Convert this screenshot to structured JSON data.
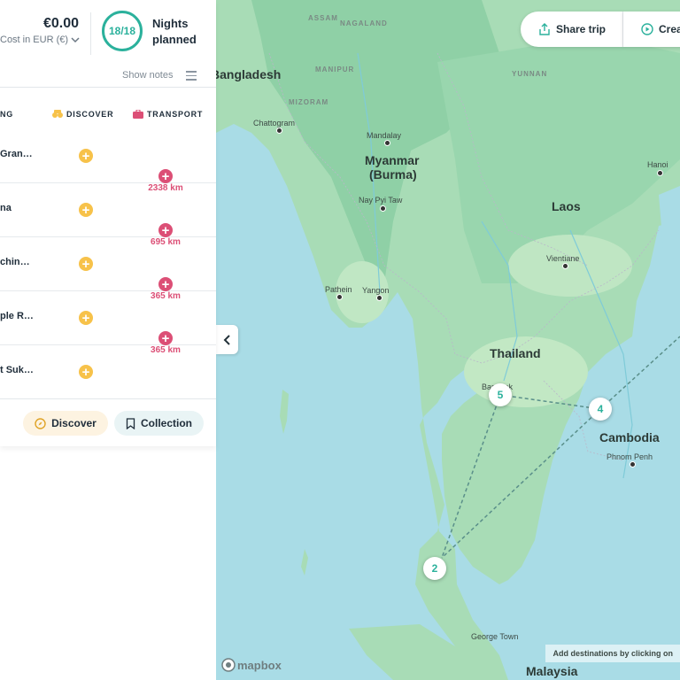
{
  "panel": {
    "cost_amount": "€0.00",
    "cost_label": "Cost in EUR (€)",
    "nights_count": "18/18",
    "nights_label_1": "Nights",
    "nights_label_2": "planned",
    "show_notes": "Show notes",
    "columns": {
      "staying": "NG",
      "discover": "DISCOVER",
      "transport": "TRANSPORT"
    },
    "rows": [
      {
        "name": "Gran…"
      },
      {
        "name": "na"
      },
      {
        "name": "chin…"
      },
      {
        "name": "ple R…"
      },
      {
        "name": "t Suk…"
      }
    ],
    "transport": [
      "2338 km",
      "695 km",
      "365 km",
      "365 km"
    ],
    "discover_button": "Discover",
    "collection_button": "Collection"
  },
  "map": {
    "share_button": "Share trip",
    "create_button": "Crea",
    "hint": "Add destinations by clicking on",
    "logo": "mapbox",
    "countries": {
      "bangladesh": "Bangladesh",
      "myanmar": "Myanmar",
      "burma": "(Burma)",
      "laos": "Laos",
      "thailand": "Thailand",
      "cambodia": "Cambodia",
      "malaysia": "Malaysia"
    },
    "regions": {
      "assam": "ASSAM",
      "nagaland": "NAGALAND",
      "manipur": "MANIPUR",
      "mizoram": "MIZORAM",
      "yunnan": "YUNNAN"
    },
    "cities": {
      "chattogram": "Chattogram",
      "mandalay": "Mandalay",
      "naypyitaw": "Nay Pyi Taw",
      "pathein": "Pathein",
      "yangon": "Yangon",
      "hanoi": "Hanoi",
      "vientiane": "Vientiane",
      "bangkok": "Bangkok",
      "phnompenh": "Phnom Penh",
      "georgetown": "George Town"
    },
    "pins": [
      "5",
      "4",
      "2"
    ],
    "colors": {
      "water": "#a9dce6",
      "land": "#a8dcb6",
      "accent": "#2bb19c",
      "pink": "#dc4f76",
      "yellow": "#f7c24a"
    }
  }
}
